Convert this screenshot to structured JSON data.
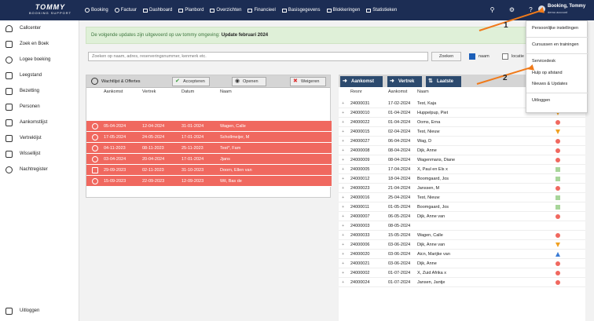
{
  "topbar": {
    "logo_main": "TOMMY",
    "logo_sub": "BOOKING SUPPORT",
    "nav": [
      "Booking",
      "Factuur",
      "Dashboard",
      "Planbord",
      "Overzichten",
      "Financieel",
      "Basisgegevens",
      "Blokkeringen",
      "Statistieken"
    ],
    "user_name": "Booking, Tommy",
    "user_sub": "demo account"
  },
  "sidebar": {
    "items": [
      "Callcenter",
      "Zoek en Boek",
      "Logee boeking",
      "Leegstand",
      "Bezetting",
      "Personen",
      "Aankomstlijst",
      "Vertreklijst",
      "Wissellijst",
      "Nachtregister"
    ],
    "logout": "Uitloggen"
  },
  "notice": {
    "text": "De volgende updates zijn uitgevoerd op uw tommy omgeving:",
    "highlight": "Update februari 2024"
  },
  "search": {
    "placeholder": "Zoeken op naam, adres, reserveringsnummer, kenmerk etc.",
    "button": "Zoeken",
    "opt1": "naam",
    "opt2": "locatie"
  },
  "wachtlijst": {
    "title": "Wachtlijst & Offertes",
    "btn_accept": "Accepteren",
    "btn_open": "Openen",
    "btn_reject": "Weigeren",
    "headers": [
      "Aankomst",
      "Vertrek",
      "Datum",
      "Naam"
    ],
    "rows": [
      [
        "05-04-2024",
        "12-04-2024",
        "31-01-2024",
        "Wagen, Calle"
      ],
      [
        "17-05-2024",
        "24-05-2024",
        "17-01-2024",
        "Schollmeijer, M"
      ],
      [
        "04-11-2023",
        "08-11-2023",
        "25-11-2023",
        "Test*, Fam"
      ],
      [
        "03-04-2024",
        "20-04-2024",
        "17-01-2024",
        "Jjans"
      ],
      [
        "29-09-2023",
        "02-11-2023",
        "31-10-2023",
        "Doorn, Ellen van"
      ],
      [
        "15-09-2023",
        "22-09-2023",
        "12-09-2023",
        "Wil, Bas de"
      ]
    ]
  },
  "arrivals": {
    "btn_aankomst": "Aankomst",
    "btn_vertrek": "Vertrek",
    "btn_laatste": "Laatste",
    "headers": [
      "Resnr",
      "Aankomst",
      "Naam"
    ],
    "rows": [
      [
        "24000031",
        "17-02-2024",
        "Test, Kaja",
        "circle-red"
      ],
      [
        "24000010",
        "01-04-2024",
        "Huppelpup, Piet",
        "tri-orange"
      ],
      [
        "24000022",
        "01-04-2024",
        "Ooms, Erna",
        "circle-red"
      ],
      [
        "24000015",
        "02-04-2024",
        "Test, Nieuw",
        "tri-orange"
      ],
      [
        "24000027",
        "06-04-2024",
        "Wag, D",
        "circle-red"
      ],
      [
        "24000008",
        "08-04-2024",
        "Dijk, Anne",
        "circle-red"
      ],
      [
        "24000009",
        "08-04-2024",
        "Wagenmans, Diane",
        "circle-red"
      ],
      [
        "24000005",
        "17-04-2024",
        "X, Paul en Els x",
        "sq-green"
      ],
      [
        "24000012",
        "18-04-2024",
        "Boomgaard, Jos",
        "sq-green"
      ],
      [
        "24000023",
        "21-04-2024",
        "Janssen, M",
        "circle-red"
      ],
      [
        "24000016",
        "25-04-2024",
        "Test, Nieuw",
        "sq-green"
      ],
      [
        "24000011",
        "01-05-2024",
        "Boomgaard, Jos",
        "sq-green"
      ],
      [
        "24000007",
        "06-05-2024",
        "Dijk, Anne van",
        "circle-red"
      ],
      [
        "24000003",
        "08-05-2024",
        "",
        ""
      ],
      [
        "24000033",
        "15-05-2024",
        "Wagen, Calle",
        "circle-red"
      ],
      [
        "24000006",
        "03-06-2024",
        "Dijk, Anne van",
        "tri-orange"
      ],
      [
        "24000020",
        "03-06-2024",
        "Aicn, Marijke van",
        "tri-blue"
      ],
      [
        "24000021",
        "03-06-2024",
        "Dijk, Anne",
        "circle-red"
      ],
      [
        "24000002",
        "01-07-2024",
        "X, Zuid Afrika x",
        "circle-red"
      ],
      [
        "24000024",
        "01-07-2024",
        "Jansen, Jantje",
        "circle-red"
      ]
    ]
  },
  "dropdown": {
    "items": [
      "Persoonlijke instellingen",
      "Cursussen en trainingen",
      "Servicedesk",
      "Hulp op afstand",
      "Nieuws & Updates",
      "Uitloggen"
    ]
  },
  "annotations": [
    "1",
    "2"
  ],
  "colors": {
    "topbar": "#1c2d54",
    "row_red": "#f0685f",
    "arrow": "#f07a1a"
  }
}
